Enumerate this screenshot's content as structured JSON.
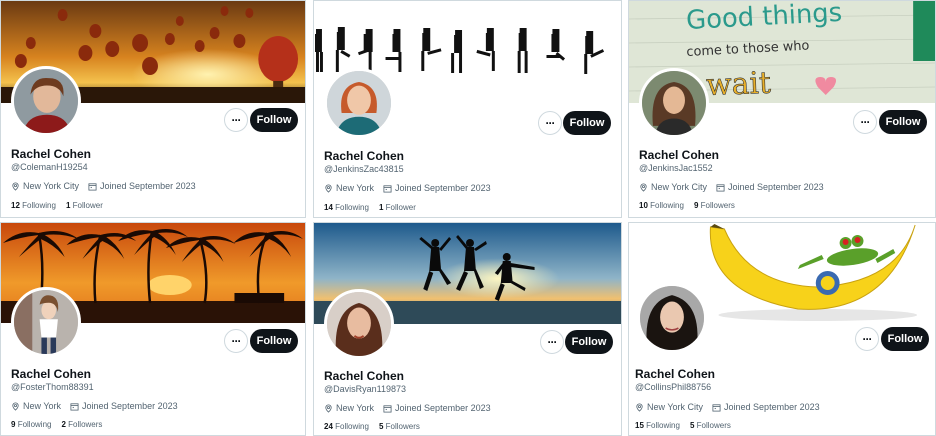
{
  "cards": [
    {
      "name": "Rachel Cohen",
      "handle": "@ColemanH19254",
      "location": "New York City",
      "joined": "Joined September 2023",
      "following_count": "12",
      "following_label": "Following",
      "followers_count": "1",
      "followers_label": "Follower",
      "follow_label": "Follow",
      "more_label": "···"
    },
    {
      "name": "Rachel Cohen",
      "handle": "@JenkinsZac43815",
      "location": "New York",
      "joined": "Joined September 2023",
      "following_count": "14",
      "following_label": "Following",
      "followers_count": "1",
      "followers_label": "Follower",
      "follow_label": "Follow",
      "more_label": "···"
    },
    {
      "name": "Rachel Cohen",
      "handle": "@JenkinsJac1552",
      "location": "New York City",
      "joined": "Joined September 2023",
      "following_count": "10",
      "following_label": "Following",
      "followers_count": "9",
      "followers_label": "Followers",
      "follow_label": "Follow",
      "more_label": "···",
      "banner_text_1": "Good things",
      "banner_text_2": "come to those who",
      "banner_text_3": "wait"
    },
    {
      "name": "Rachel Cohen",
      "handle": "@FosterThom88391",
      "location": "New York",
      "joined": "Joined September 2023",
      "following_count": "9",
      "following_label": "Following",
      "followers_count": "2",
      "followers_label": "Followers",
      "follow_label": "Follow",
      "more_label": "···"
    },
    {
      "name": "Rachel Cohen",
      "handle": "@DavisRyan119873",
      "location": "New York",
      "joined": "Joined September 2023",
      "following_count": "24",
      "following_label": "Following",
      "followers_count": "5",
      "followers_label": "Followers",
      "follow_label": "Follow",
      "more_label": "···"
    },
    {
      "name": "Rachel Cohen",
      "handle": "@CollinsPhil88756",
      "location": "New York City",
      "joined": "Joined September 2023",
      "following_count": "15",
      "following_label": "Following",
      "followers_count": "5",
      "followers_label": "Followers",
      "follow_label": "Follow",
      "more_label": "···"
    }
  ],
  "colors": {
    "follow_bg": "#0f1419",
    "secondary_text": "#536471",
    "border": "#cfd9de"
  }
}
